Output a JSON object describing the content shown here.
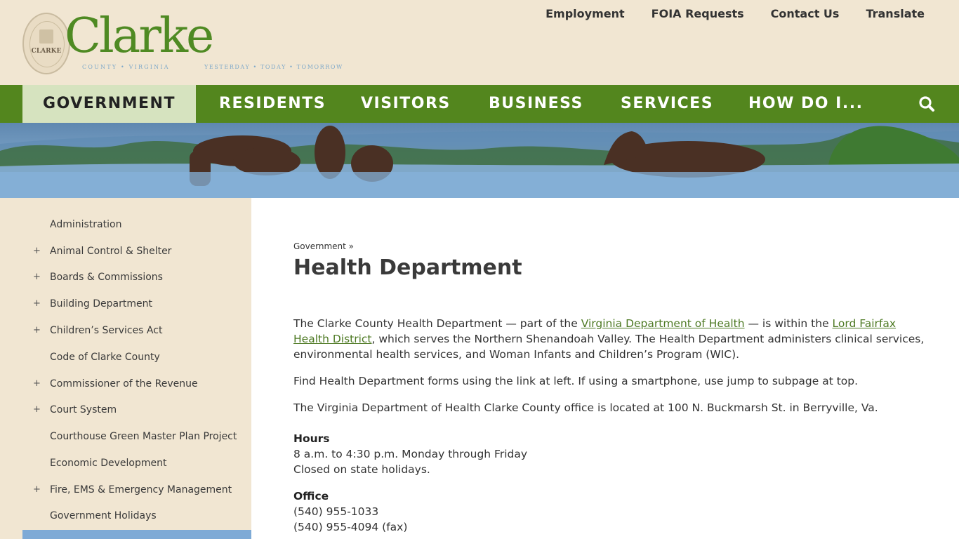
{
  "header": {
    "seal_text": "CLARKE",
    "logo_word": "Clarke",
    "tagline_left": "COUNTY • VIRGINIA",
    "tagline_right": "YESTERDAY • TODAY • TOMORROW",
    "utility_links": [
      "Employment",
      "FOIA Requests",
      "Contact Us",
      "Translate"
    ]
  },
  "nav": {
    "items": [
      "GOVERNMENT",
      "RESIDENTS",
      "VISITORS",
      "BUSINESS",
      "SERVICES",
      "HOW DO I..."
    ],
    "active": "GOVERNMENT",
    "search_icon": "search-icon"
  },
  "sidebar": {
    "items": [
      {
        "label": "Administration",
        "expandable": false
      },
      {
        "label": "Animal Control & Shelter",
        "expandable": true
      },
      {
        "label": "Boards & Commissions",
        "expandable": true
      },
      {
        "label": "Building Department",
        "expandable": true
      },
      {
        "label": "Children’s Services Act",
        "expandable": true
      },
      {
        "label": "Code of Clarke County",
        "expandable": false
      },
      {
        "label": "Commissioner of the Revenue",
        "expandable": true
      },
      {
        "label": "Court System",
        "expandable": true
      },
      {
        "label": "Courthouse Green Master Plan Project",
        "expandable": false
      },
      {
        "label": "Economic Development",
        "expandable": false
      },
      {
        "label": "Fire, EMS & Emergency Management",
        "expandable": true
      },
      {
        "label": "Government Holidays",
        "expandable": false
      }
    ],
    "plus": "+"
  },
  "content": {
    "breadcrumb": "Government »",
    "title": "Health Department",
    "p1_before": "The Clarke County Health Department — part of the ",
    "p1_link1": "Virginia Department of Health",
    "p1_mid": " — is within the ",
    "p1_link2": "Lord Fairfax Health District",
    "p1_after": ", which serves the Northern Shenandoah Valley. The Health Department administers clinical services, environmental health services, and Woman Infants and Children’s Program (WIC).",
    "p2": "Find Health Department forms using the link at left. If using a smartphone, use jump to subpage at top.",
    "p3": "The Virginia Department of Health Clarke County office is located at 100 N. Buckmarsh St. in Berryville, Va.",
    "hours_label": "Hours",
    "hours_line1": "8 a.m. to 4:30 p.m. Monday through Friday",
    "hours_line2": "Closed on state holidays.",
    "office_label": "Office",
    "office_phone": "(540) 955-1033",
    "office_fax": "(540) 955-4094 (fax)"
  },
  "colors": {
    "nav_green": "#53861e",
    "active_tab": "#d6e3bf",
    "beige": "#f1e6d2",
    "link_green": "#4e7a24",
    "sidebar_active": "#7eaad6"
  }
}
